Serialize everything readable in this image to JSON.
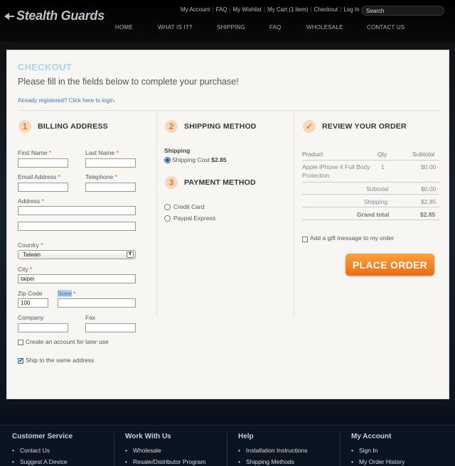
{
  "header": {
    "logo_text": "Stealth Guards",
    "top_links": [
      "My Account",
      "FAQ",
      "My Wishlist",
      "My Cart (1 item)",
      "Checkout",
      "Log In"
    ],
    "search_placeholder": "Search",
    "nav": [
      "HOME",
      "WHAT IS IT?",
      "SHIPPING",
      "FAQ",
      "WHOLESALE",
      "CONTACT US"
    ]
  },
  "checkout": {
    "title": "CHECKOUT",
    "subtitle": "Please fill in the fields below to complete your purchase!",
    "login_link": "Already registered? Click here to login."
  },
  "billing": {
    "step": "1",
    "title": "BILLING ADDRESS",
    "first_name_label": "First Name",
    "last_name_label": "Last Name",
    "email_label": "Email Address",
    "telephone_label": "Telephone",
    "address_label": "Address",
    "country_label": "Country",
    "country_value": "Taiwan",
    "city_label": "City",
    "city_value": "taipei",
    "zip_label": "Zip Code",
    "zip_value": "100",
    "state_label": "State",
    "company_label": "Company",
    "fax_label": "Fax",
    "required_mark": "*",
    "create_account_label": "Create an account for later use",
    "ship_same_label": "Ship to the same address"
  },
  "shipping": {
    "step": "2",
    "title": "SHIPPING METHOD",
    "group_label": "Shipping",
    "option_label": "Shipping Cost",
    "option_price": "$2.85"
  },
  "payment": {
    "step": "3",
    "title": "PAYMENT METHOD",
    "options": [
      "Credit Card",
      "Paypal Express"
    ]
  },
  "review": {
    "title": "REVIEW YOUR ORDER",
    "col_product": "Product",
    "col_qty": "Qty",
    "col_subtotal": "Subtotal",
    "item_name_line1": "Apple iPhone 4 Full Body",
    "item_name_line2": "Protection",
    "item_qty": "1",
    "item_subtotal": "$0.00",
    "subtotal_label": "Subtotal",
    "subtotal_value": "$0.00",
    "shipping_label": "Shipping",
    "shipping_value": "$2.85",
    "grand_label": "Grand total",
    "grand_value": "$2.85",
    "gift_label": "Add a gift message to my order",
    "place_order_label": "PLACE ORDER"
  },
  "footer": {
    "columns": [
      {
        "title": "Customer Service",
        "items": [
          "Contact Us",
          "Suggest A Device"
        ]
      },
      {
        "title": "Work With Us",
        "items": [
          "Wholesale",
          "Resale/Distributor Program"
        ]
      },
      {
        "title": "Help",
        "items": [
          "Installation Instructions",
          "Shipping Methods"
        ]
      },
      {
        "title": "My Account",
        "items": [
          "Sign In",
          "My Order History"
        ]
      }
    ]
  },
  "colors": {
    "accent_orange": "#ec6c10",
    "checkout_blue": "#a8d4ee",
    "link_blue": "#3a7bb8"
  }
}
